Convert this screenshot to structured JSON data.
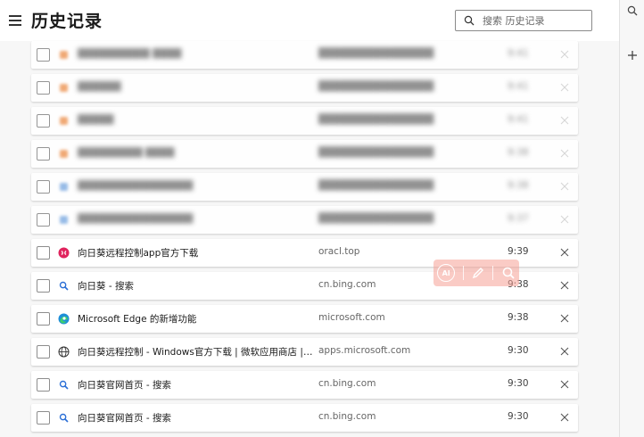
{
  "header": {
    "title": "历史记录",
    "search_placeholder": "搜索 历史记录"
  },
  "rightbar": {
    "icons": [
      "search-icon",
      "plus-icon"
    ]
  },
  "history": [
    {
      "title": "██████████ ████",
      "domain": "████████████████",
      "time": "9:41",
      "favicon": "orange-icon",
      "blurred": true
    },
    {
      "title": "██████",
      "domain": "████████████████",
      "time": "9:41",
      "favicon": "orange-icon",
      "blurred": true
    },
    {
      "title": "█████",
      "domain": "████████████████",
      "time": "9:41",
      "favicon": "orange-icon",
      "blurred": true
    },
    {
      "title": "█████████ ████",
      "domain": "████████████████",
      "time": "9:38",
      "favicon": "orange-icon",
      "blurred": true
    },
    {
      "title": "████████████████",
      "domain": "████████████████",
      "time": "9:38",
      "favicon": "blue-icon",
      "blurred": true
    },
    {
      "title": "████████████████",
      "domain": "████████████████",
      "time": "9:37",
      "favicon": "blue-icon",
      "blurred": true
    },
    {
      "title": "向日葵远程控制app官方下载",
      "domain": "oracl.top",
      "time": "9:39",
      "favicon": "sunflower-icon",
      "blurred": false
    },
    {
      "title": "向日葵 - 搜索",
      "domain": "cn.bing.com",
      "time": "9:38",
      "favicon": "search-icon",
      "blurred": false
    },
    {
      "title": "Microsoft Edge 的新增功能",
      "domain": "microsoft.com",
      "time": "9:38",
      "favicon": "edge-icon",
      "blurred": false
    },
    {
      "title": "向日葵远程控制 - Windows官方下载 | 微软应用商店 | Micro...",
      "domain": "apps.microsoft.com",
      "time": "9:30",
      "favicon": "globe-icon",
      "blurred": false
    },
    {
      "title": "向日葵官网首页 - 搜索",
      "domain": "cn.bing.com",
      "time": "9:30",
      "favicon": "search-icon",
      "blurred": false
    },
    {
      "title": "向日葵官网首页 - 搜索",
      "domain": "cn.bing.com",
      "time": "9:30",
      "favicon": "search-icon",
      "blurred": false
    }
  ],
  "overlay": {
    "logo_text": "AI"
  },
  "colors": {
    "accent": "#2b6fd6",
    "sunflower": "#e0245e",
    "watermark": "#f6a096"
  }
}
